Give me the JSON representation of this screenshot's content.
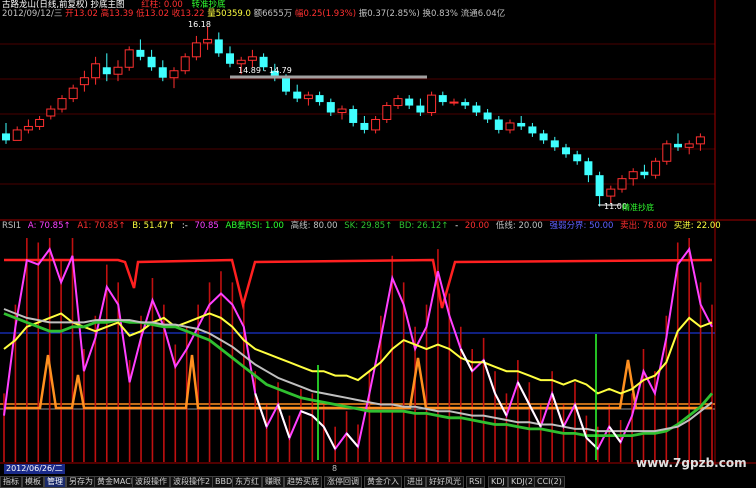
{
  "main_header": {
    "title": "古路龙山(日线,前复权)",
    "formula": "抄底主图",
    "date": "2012/09/12/三",
    "open": "开13.02",
    "high": "高13.39",
    "low": "低13.02",
    "close": "收13.22",
    "volume": "量50359.0",
    "amount": "额6655万",
    "change_pct": "幅0.25(1.93%)",
    "change": "振0.37(2.85%)",
    "turnover": "换0.83%",
    "float_cap": "流通6.04亿",
    "red_label": "红柱: 0.00",
    "signal_label": "转准抄底"
  },
  "main_chart": {
    "high_label": "16.18",
    "band_label": "14.89 - 14.79",
    "low_label": "11.00",
    "low_signal": "精准抄底"
  },
  "rsi_header": {
    "name": "RSI1",
    "a": "A: 70.85↑",
    "a1": "A1: 70.85↑",
    "b": "B: 51.47↑",
    "dash": ":-",
    "v4": "70.85",
    "ab": "AB差RSI: 1.00",
    "high_line": "高线: 80.00",
    "sk": "SK: 29.85↑",
    "bd": "BD: 26.12↑",
    "dash2": "-",
    "hidden": "20.00",
    "low_line": "低线: 20.00",
    "signal": "强弱分界: 50.00",
    "sell": "卖出: 78.00",
    "buy": "买进: 22.00"
  },
  "bottom_axis": {
    "date_box": "2012/06/26/二",
    "month_label": "8"
  },
  "watermark": "www.7gpzb.com",
  "tabs": [
    "指标",
    "模板",
    "管理",
    "另存为",
    "黄金MACD",
    "波段操作",
    "波段操作2",
    "BBD",
    "东方红",
    "赚眼",
    "趋势买底",
    "涨停回调",
    "黄金介入",
    "进出",
    "好好风光",
    "RSI",
    "KDJ",
    "KDJ(2)",
    "CCI(2)"
  ],
  "active_tab": "管理",
  "chart_data": [
    {
      "type": "candlestick",
      "title": "古路龙山(日线,前复权)",
      "ylim": [
        11.0,
        16.18
      ],
      "ohlc": [
        [
          13.1,
          13.4,
          12.8,
          12.9
        ],
        [
          12.9,
          13.3,
          12.9,
          13.2
        ],
        [
          13.2,
          13.5,
          13.1,
          13.3
        ],
        [
          13.3,
          13.6,
          13.2,
          13.5
        ],
        [
          13.6,
          13.9,
          13.5,
          13.8
        ],
        [
          13.8,
          14.2,
          13.7,
          14.1
        ],
        [
          14.1,
          14.5,
          14.0,
          14.4
        ],
        [
          14.5,
          14.9,
          14.3,
          14.7
        ],
        [
          14.7,
          15.3,
          14.5,
          15.1
        ],
        [
          15.0,
          15.4,
          14.6,
          14.8
        ],
        [
          14.8,
          15.2,
          14.6,
          15.0
        ],
        [
          15.0,
          15.6,
          14.9,
          15.5
        ],
        [
          15.5,
          15.8,
          15.2,
          15.3
        ],
        [
          15.3,
          15.5,
          14.9,
          15.0
        ],
        [
          15.0,
          15.2,
          14.6,
          14.7
        ],
        [
          14.7,
          15.0,
          14.4,
          14.9
        ],
        [
          14.9,
          15.4,
          14.8,
          15.3
        ],
        [
          15.3,
          15.9,
          15.2,
          15.7
        ],
        [
          15.7,
          16.18,
          15.5,
          15.8
        ],
        [
          15.8,
          16.0,
          15.3,
          15.4
        ],
        [
          15.4,
          15.6,
          15.0,
          15.1
        ],
        [
          15.1,
          15.3,
          14.8,
          15.2
        ],
        [
          15.2,
          15.5,
          15.0,
          15.3
        ],
        [
          15.3,
          15.4,
          14.9,
          15.0
        ],
        [
          14.9,
          15.1,
          14.6,
          14.7
        ],
        [
          14.7,
          14.8,
          14.2,
          14.3
        ],
        [
          14.3,
          14.5,
          14.0,
          14.1
        ],
        [
          14.1,
          14.3,
          13.9,
          14.2
        ],
        [
          14.2,
          14.3,
          13.9,
          14.0
        ],
        [
          14.0,
          14.1,
          13.6,
          13.7
        ],
        [
          13.7,
          13.9,
          13.5,
          13.8
        ],
        [
          13.8,
          13.9,
          13.3,
          13.4
        ],
        [
          13.4,
          13.6,
          13.1,
          13.2
        ],
        [
          13.2,
          13.6,
          13.1,
          13.5
        ],
        [
          13.5,
          14.0,
          13.4,
          13.9
        ],
        [
          13.9,
          14.2,
          13.8,
          14.1
        ],
        [
          14.1,
          14.2,
          13.8,
          13.9
        ],
        [
          13.9,
          14.1,
          13.6,
          13.7
        ],
        [
          13.7,
          14.3,
          13.6,
          14.2
        ],
        [
          14.2,
          14.3,
          13.9,
          14.0
        ],
        [
          14.0,
          14.1,
          13.9,
          14.0
        ],
        [
          14.0,
          14.1,
          13.8,
          13.9
        ],
        [
          13.9,
          14.0,
          13.6,
          13.7
        ],
        [
          13.7,
          13.8,
          13.4,
          13.5
        ],
        [
          13.5,
          13.6,
          13.1,
          13.2
        ],
        [
          13.2,
          13.5,
          13.1,
          13.4
        ],
        [
          13.4,
          13.6,
          13.2,
          13.3
        ],
        [
          13.3,
          13.4,
          13.0,
          13.1
        ],
        [
          13.1,
          13.2,
          12.8,
          12.9
        ],
        [
          12.9,
          13.0,
          12.6,
          12.7
        ],
        [
          12.7,
          12.8,
          12.4,
          12.5
        ],
        [
          12.5,
          12.6,
          12.2,
          12.3
        ],
        [
          12.3,
          12.4,
          11.7,
          11.9
        ],
        [
          11.9,
          12.0,
          11.0,
          11.3
        ],
        [
          11.3,
          11.6,
          11.1,
          11.5
        ],
        [
          11.5,
          11.9,
          11.4,
          11.8
        ],
        [
          11.8,
          12.1,
          11.6,
          12.0
        ],
        [
          12.0,
          12.2,
          11.8,
          11.9
        ],
        [
          11.9,
          12.4,
          11.8,
          12.3
        ],
        [
          12.3,
          12.9,
          12.2,
          12.8
        ],
        [
          12.8,
          13.1,
          12.6,
          12.7
        ],
        [
          12.7,
          12.9,
          12.5,
          12.8
        ],
        [
          12.8,
          13.1,
          12.6,
          13.0
        ]
      ]
    },
    {
      "type": "line",
      "title": "RSI1",
      "ylim": [
        0,
        100
      ],
      "levels": [
        80,
        20,
        50
      ],
      "series": [
        {
          "name": "A",
          "color": "#ff40ff",
          "values": [
            20,
            60,
            90,
            88,
            95,
            80,
            92,
            40,
            55,
            78,
            70,
            35,
            55,
            72,
            60,
            42,
            50,
            60,
            70,
            75,
            70,
            60,
            30,
            15,
            25,
            10,
            22,
            20,
            15,
            5,
            12,
            6,
            30,
            55,
            82,
            70,
            50,
            60,
            85,
            65,
            50,
            40,
            45,
            30,
            20,
            35,
            25,
            15,
            30,
            15,
            25,
            10,
            5,
            15,
            8,
            20,
            40,
            30,
            55,
            88,
            95,
            70,
            60
          ]
        },
        {
          "name": "B",
          "color": "#ffff40",
          "values": [
            50,
            54,
            60,
            62,
            64,
            66,
            62,
            60,
            58,
            60,
            62,
            56,
            58,
            62,
            64,
            60,
            62,
            64,
            66,
            64,
            60,
            54,
            50,
            48,
            46,
            44,
            42,
            40,
            40,
            38,
            38,
            36,
            40,
            44,
            50,
            54,
            52,
            50,
            52,
            50,
            46,
            44,
            44,
            42,
            40,
            40,
            38,
            36,
            36,
            34,
            36,
            34,
            30,
            32,
            30,
            32,
            36,
            38,
            44,
            58,
            64,
            60,
            62
          ]
        },
        {
          "name": "SK",
          "color": "#30c030",
          "values": [
            66,
            64,
            62,
            60,
            58,
            58,
            60,
            60,
            62,
            62,
            63,
            62,
            62,
            61,
            60,
            60,
            58,
            56,
            54,
            50,
            46,
            42,
            38,
            34,
            32,
            30,
            28,
            27,
            26,
            25,
            24,
            23,
            22,
            22,
            22,
            22,
            21,
            21,
            20,
            19,
            19,
            18,
            17,
            16,
            16,
            15,
            14,
            14,
            13,
            12,
            12,
            11,
            11,
            11,
            11,
            11,
            12,
            12,
            13,
            16,
            20,
            24,
            30
          ]
        },
        {
          "name": "BD",
          "color": "#c0c0c0",
          "values": [
            68,
            66,
            64,
            63,
            62,
            62,
            62,
            62,
            63,
            63,
            63,
            63,
            62,
            62,
            61,
            61,
            60,
            59,
            57,
            54,
            51,
            47,
            43,
            40,
            37,
            35,
            33,
            31,
            30,
            29,
            28,
            27,
            26,
            25,
            25,
            24,
            24,
            23,
            22,
            22,
            21,
            20,
            20,
            19,
            18,
            17,
            17,
            16,
            16,
            15,
            14,
            14,
            13,
            13,
            13,
            13,
            13,
            13,
            14,
            15,
            18,
            22,
            26
          ]
        }
      ]
    }
  ]
}
